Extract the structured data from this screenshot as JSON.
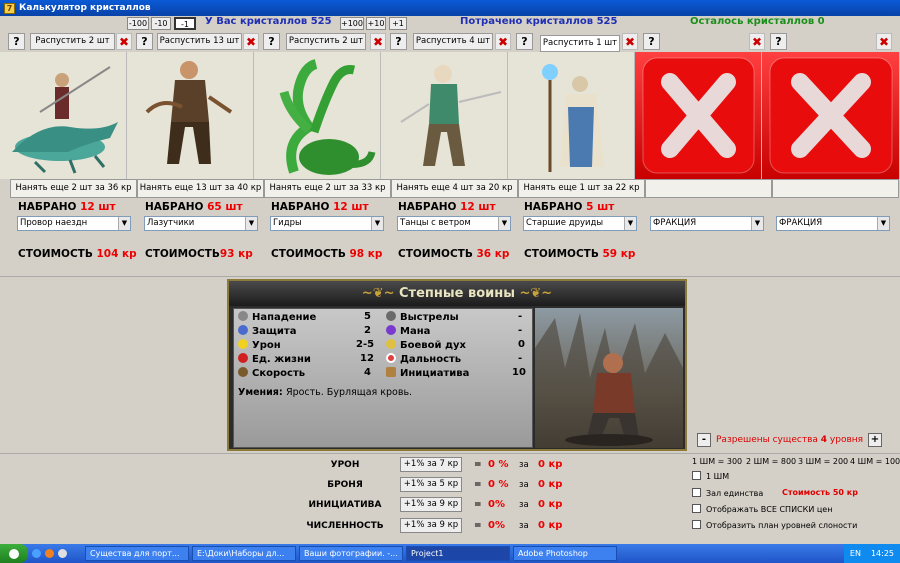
{
  "window": {
    "title": "Калькулятор кристаллов",
    "icon_letter": "7"
  },
  "header": {
    "step_buttons_minus": [
      "-100",
      "-10",
      "-1"
    ],
    "step_buttons_plus": [
      "+100",
      "+10",
      "+1"
    ],
    "have_crystals": "У Вас кристаллов 525",
    "spent_crystals": "Потрачено кристаллов 525",
    "left_crystals": "Осталось кристаллов 0",
    "colors": {
      "have": "#1f2fb5",
      "spent": "#1f2fb5",
      "left": "#1a8f1a"
    }
  },
  "slots": [
    {
      "dismiss": "Распустить 2 шт",
      "hire": "Нанять еще 2 шт за 36 кр",
      "recruited_label": "НАБРАНО",
      "recruited": "12 шт",
      "unit": "Провор наездн",
      "cost_label": "СТОИМОСТЬ",
      "cost": "104 кр",
      "image": "lizard-rider"
    },
    {
      "dismiss": "Распустить 13 шт",
      "hire": "Нанять еще 13 шт за 40 кр",
      "recruited_label": "НАБРАНО",
      "recruited": "65 шт",
      "unit": "Лазутчики",
      "cost_label": "СТОИМОСТЬ",
      "cost": "93 кр",
      "image": "scout"
    },
    {
      "dismiss": "Распустить 2 шт",
      "hire": "Нанять еще 2 шт за 33 кр",
      "recruited_label": "НАБРАНО",
      "recruited": "12 шт",
      "unit": "Гидры",
      "cost_label": "СТОИМОСТЬ",
      "cost": "98 кр",
      "image": "hydra"
    },
    {
      "dismiss": "Распустить 4 шт",
      "hire": "Нанять еще 4 шт за 20 кр",
      "recruited_label": "НАБРАНО",
      "recruited": "12 шт",
      "unit": "Танцы с ветром",
      "cost_label": "СТОИМОСТЬ",
      "cost": "36 кр",
      "image": "wind-dancer"
    },
    {
      "dismiss": "Распустить 1 шт",
      "hire": "Нанять еще 1 шт за 22 кр",
      "recruited_label": "НАБРАНО",
      "recruited": "5 шт",
      "unit": "Старшие друиды",
      "cost_label": "СТОИМОСТЬ",
      "cost": "59 кр",
      "image": "druid"
    },
    {
      "dismiss": "",
      "hire": "",
      "unit": "ФРАКЦИЯ",
      "image": "empty-x"
    },
    {
      "dismiss": "",
      "hire": "",
      "unit": "ФРАКЦИЯ",
      "image": "empty-x"
    }
  ],
  "help_label": "?",
  "close_label": "✖",
  "creature": {
    "name": "Степные воины",
    "stats_left": [
      {
        "label": "Нападение",
        "value": "5",
        "icon": "sword-icon"
      },
      {
        "label": "Защита",
        "value": "2",
        "icon": "shield-icon"
      },
      {
        "label": "Урон",
        "value": "2-5",
        "icon": "damage-icon"
      },
      {
        "label": "Ед. жизни",
        "value": "12",
        "icon": "heart-icon"
      },
      {
        "label": "Скорость",
        "value": "4",
        "icon": "boot-icon"
      }
    ],
    "stats_right": [
      {
        "label": "Выстрелы",
        "value": "-",
        "icon": "arrow-icon"
      },
      {
        "label": "Мана",
        "value": "-",
        "icon": "mana-icon"
      },
      {
        "label": "Боевой дух",
        "value": "0",
        "icon": "morale-icon"
      },
      {
        "label": "Дальность",
        "value": "-",
        "icon": "target-icon"
      },
      {
        "label": "Инициатива",
        "value": "10",
        "icon": "hourglass-icon"
      }
    ],
    "skills_label": "Умения:",
    "skills": "Ярость.  Бурлящая кровь."
  },
  "level_control": {
    "minus": "-",
    "plus": "+",
    "text": "Разрешены существа",
    "level": "4",
    "suffix": "уровня"
  },
  "shm_rates": [
    "1 ШМ = 300",
    "2 ШМ = 800",
    "3 ШМ = 200",
    "4 ШМ = 100"
  ],
  "options": [
    {
      "label": "1 ШМ",
      "extra": ""
    },
    {
      "label": "Зал единства",
      "extra": "Стоимость 50 кр"
    },
    {
      "label": "Отображать ВСЕ СПИСКИ цен",
      "extra": ""
    },
    {
      "label": "Отобразить план уровней слоности",
      "extra": ""
    }
  ],
  "upgrades": [
    {
      "label": "УРОН",
      "button": "+1% за 7 кр",
      "eq": "=",
      "pct": "0 %",
      "za": "за",
      "kr": "0 кр"
    },
    {
      "label": "БРОНЯ",
      "button": "+1% за 5 кр",
      "eq": "=",
      "pct": "0 %",
      "za": "за",
      "kr": "0 кр"
    },
    {
      "label": "ИНИЦИАТИВА",
      "button": "+1% за 9 кр",
      "eq": "=",
      "pct": "0%",
      "za": "за",
      "kr": "0 кр"
    },
    {
      "label": "ЧИСЛЕННОСТЬ",
      "button": "+1% за 9 кр",
      "eq": "=",
      "pct": "0%",
      "za": "за",
      "kr": "0 кр"
    }
  ],
  "taskbar": {
    "items": [
      "Существа для порт...",
      "E:\\Доки\\Наборы дл...",
      "Ваши фотографии. -...",
      "Project1",
      "Adobe Photoshop"
    ],
    "active_index": 3,
    "lang": "EN",
    "clock": "14:25"
  }
}
